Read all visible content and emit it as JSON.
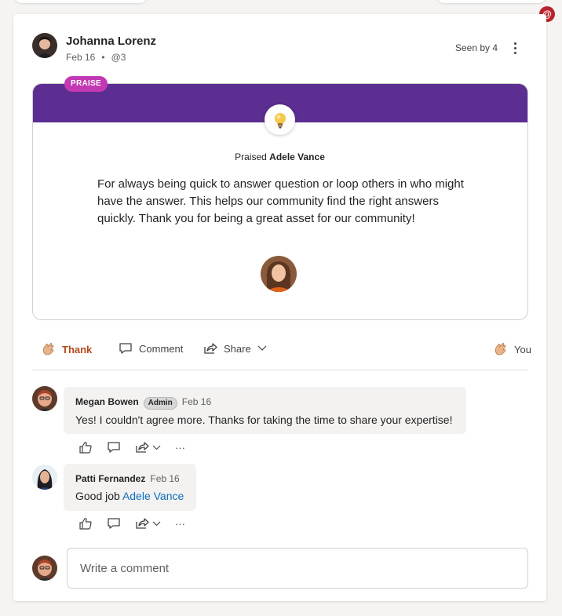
{
  "notifications": {
    "mention_symbol": "@",
    "badge_color": "#b8242c"
  },
  "post": {
    "author": "Johanna Lorenz",
    "date": "Feb 16",
    "meta_separator": "•",
    "mention_count": "@3",
    "seen_by": "Seen by 4"
  },
  "praise": {
    "badge": "PRAISE",
    "banner_color": "#5c2e91",
    "badge_color": "#c239b3",
    "icon": "lightbulb-icon",
    "praised_prefix": "Praised",
    "praised_name": "Adele Vance",
    "message": "For always being quick to answer question or loop others in who might have the answer. This helps our community find the right answers quickly. Thank you for being a great asset for our community!"
  },
  "actions": {
    "thank_label": "Thank",
    "comment_label": "Comment",
    "share_label": "Share",
    "reacted_label": "You",
    "thank_color": "#b34a1c"
  },
  "comments": [
    {
      "author": "Megan Bowen",
      "badge": "Admin",
      "date": "Feb 16",
      "text": "Yes! I couldn't agree more. Thanks for taking the time to share your expertise!"
    },
    {
      "author": "Patti Fernandez",
      "date": "Feb 16",
      "text_prefix": "Good job ",
      "mention": "Adele Vance"
    }
  ],
  "comment_actions": {
    "more": "···"
  },
  "composer": {
    "placeholder": "Write a comment"
  }
}
